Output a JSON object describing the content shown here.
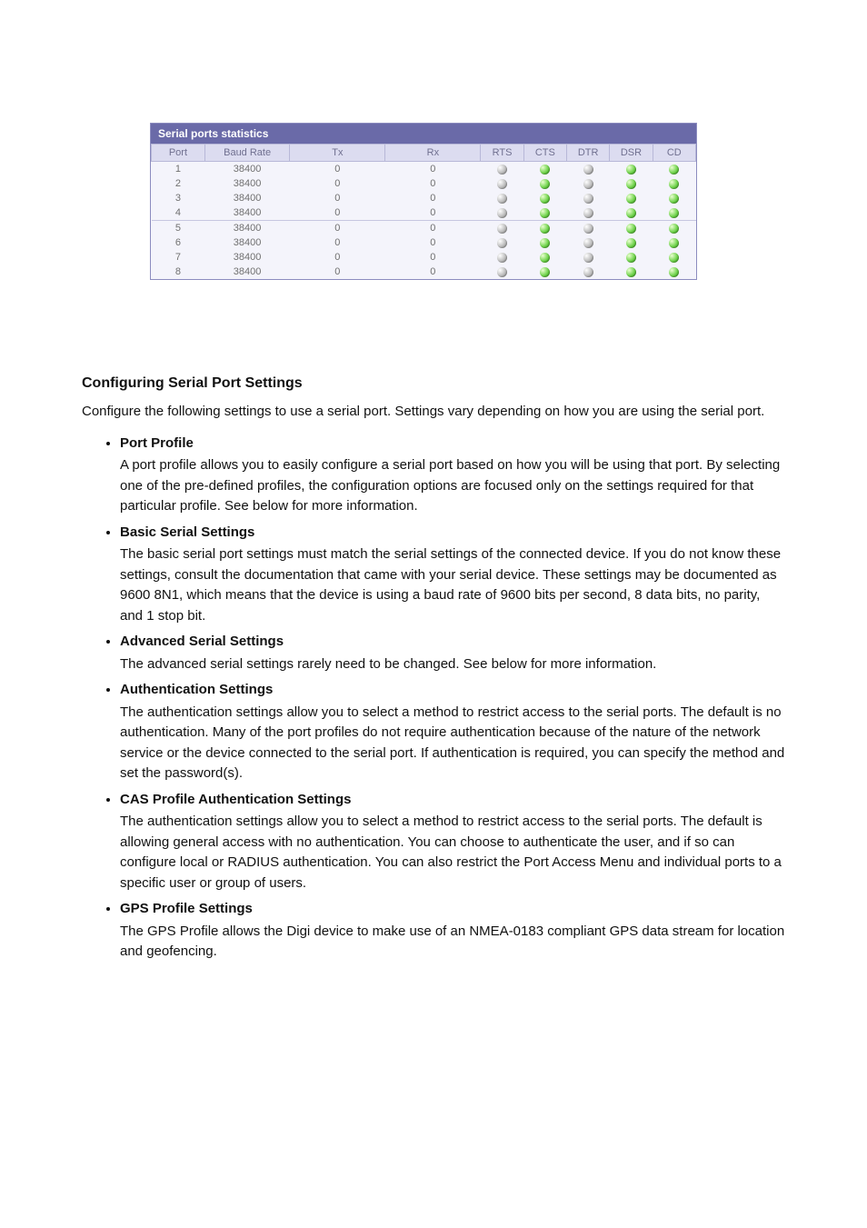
{
  "panel": {
    "title": "Serial ports statistics",
    "columns": [
      "Port",
      "Baud Rate",
      "Tx",
      "Rx",
      "RTS",
      "CTS",
      "DTR",
      "DSR",
      "CD"
    ],
    "rows": [
      {
        "port": "1",
        "baud": "38400",
        "tx": "0",
        "rx": "0",
        "rts": 0,
        "cts": 1,
        "dtr": 0,
        "dsr": 1,
        "cd": 1
      },
      {
        "port": "2",
        "baud": "38400",
        "tx": "0",
        "rx": "0",
        "rts": 0,
        "cts": 1,
        "dtr": 0,
        "dsr": 1,
        "cd": 1
      },
      {
        "port": "3",
        "baud": "38400",
        "tx": "0",
        "rx": "0",
        "rts": 0,
        "cts": 1,
        "dtr": 0,
        "dsr": 1,
        "cd": 1
      },
      {
        "port": "4",
        "baud": "38400",
        "tx": "0",
        "rx": "0",
        "rts": 0,
        "cts": 1,
        "dtr": 0,
        "dsr": 1,
        "cd": 1
      },
      {
        "port": "5",
        "baud": "38400",
        "tx": "0",
        "rx": "0",
        "rts": 0,
        "cts": 1,
        "dtr": 0,
        "dsr": 1,
        "cd": 1
      },
      {
        "port": "6",
        "baud": "38400",
        "tx": "0",
        "rx": "0",
        "rts": 0,
        "cts": 1,
        "dtr": 0,
        "dsr": 1,
        "cd": 1
      },
      {
        "port": "7",
        "baud": "38400",
        "tx": "0",
        "rx": "0",
        "rts": 0,
        "cts": 1,
        "dtr": 0,
        "dsr": 1,
        "cd": 1
      },
      {
        "port": "8",
        "baud": "38400",
        "tx": "0",
        "rx": "0",
        "rts": 0,
        "cts": 1,
        "dtr": 0,
        "dsr": 1,
        "cd": 1
      }
    ]
  },
  "chart_data": {
    "type": "table",
    "title": "Serial ports statistics",
    "columns": [
      "Port",
      "Baud Rate",
      "Tx",
      "Rx",
      "RTS",
      "CTS",
      "DTR",
      "DSR",
      "CD"
    ],
    "rows": [
      [
        1,
        38400,
        0,
        0,
        "off",
        "on",
        "off",
        "on",
        "on"
      ],
      [
        2,
        38400,
        0,
        0,
        "off",
        "on",
        "off",
        "on",
        "on"
      ],
      [
        3,
        38400,
        0,
        0,
        "off",
        "on",
        "off",
        "on",
        "on"
      ],
      [
        4,
        38400,
        0,
        0,
        "off",
        "on",
        "off",
        "on",
        "on"
      ],
      [
        5,
        38400,
        0,
        0,
        "off",
        "on",
        "off",
        "on",
        "on"
      ],
      [
        6,
        38400,
        0,
        0,
        "off",
        "on",
        "off",
        "on",
        "on"
      ],
      [
        7,
        38400,
        0,
        0,
        "off",
        "on",
        "off",
        "on",
        "on"
      ],
      [
        8,
        38400,
        0,
        0,
        "off",
        "on",
        "off",
        "on",
        "on"
      ]
    ]
  },
  "doc": {
    "heading": "Configuring Serial Port Settings",
    "intro": "Configure the following settings to use a serial port. Settings vary depending on how you are using the serial port.",
    "items": [
      {
        "head": "Port Profile",
        "body": "A port profile allows you to easily configure a serial port based on how you will be using that port. By selecting one of the pre-defined profiles, the configuration options are focused only on the settings required for that particular profile. See below for more information."
      },
      {
        "head": "Basic Serial Settings",
        "body": "The basic serial port settings must match the serial settings of the connected device. If you do not know these settings, consult the documentation that came with your serial device. These settings may be documented as 9600 8N1, which means that the device is using a baud rate of 9600 bits per second, 8 data bits, no parity, and 1 stop bit."
      },
      {
        "head": "Advanced Serial Settings",
        "body": "The advanced serial settings rarely need to be changed. See below for more information."
      },
      {
        "head": "Authentication Settings",
        "body": "The authentication settings allow you to select a method to restrict access to the serial ports. The default is no authentication. Many of the port profiles do not require authentication because of the nature of the network service or the device connected to the serial port. If authentication is required, you can specify the method and set the password(s)."
      },
      {
        "head": "CAS Profile Authentication Settings",
        "body": "The authentication settings allow you to select a method to restrict access to the serial ports. The default is allowing general access with no authentication. You can choose to authenticate the user, and if so can configure local or RADIUS authentication. You can also restrict the Port Access Menu and individual ports to a specific user or group of users."
      },
      {
        "head": "GPS Profile Settings",
        "body": "The GPS Profile allows the Digi device to make use of an NMEA-0183 compliant GPS data stream for location and geofencing."
      }
    ]
  }
}
